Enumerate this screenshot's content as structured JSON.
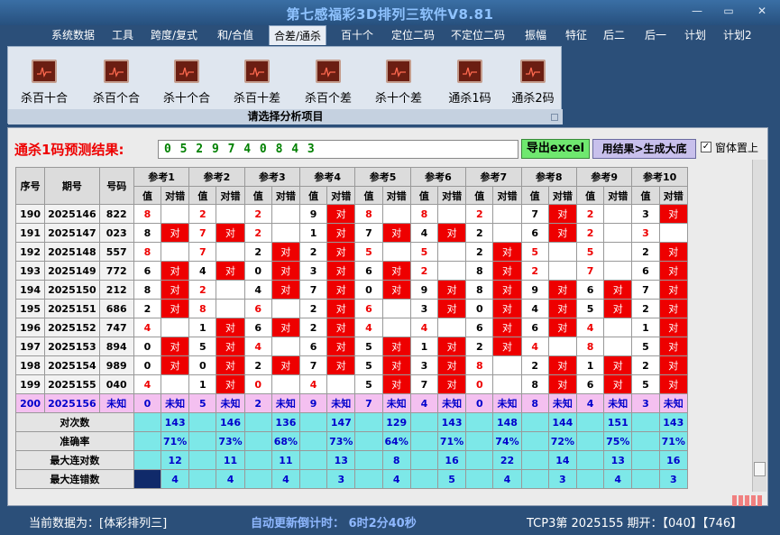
{
  "window": {
    "title": "第七感福彩3D排列三软件V8.81",
    "min": "—",
    "restore": "▭",
    "close": "✕"
  },
  "menu": [
    "系统数据",
    "工具",
    "跨度/复式",
    "和/合值",
    "合差/通杀",
    "百十个",
    "定位二码",
    "不定位二码",
    "振幅",
    "特征",
    "后二",
    "后一",
    "计划",
    "计划2"
  ],
  "active_menu": "合差/通杀",
  "tools": [
    "杀百十合",
    "杀百个合",
    "杀十个合",
    "杀百十差",
    "杀百个差",
    "杀十个差",
    "通杀1码",
    "通杀2码"
  ],
  "panel_caption": "请选择分析项目",
  "prediction": {
    "label": "通杀1码预测结果:",
    "value": "0 5 2 9 7 4 0 8 4 3"
  },
  "buttons": {
    "export": "导出excel",
    "generate": "用结果>生成大底",
    "ontop": "窗体置上",
    "ontop_check": "✓"
  },
  "table": {
    "head": {
      "seq": "序号",
      "period": "期号",
      "code": "号码",
      "val": "值",
      "chk": "对错"
    },
    "refs": [
      "参考1",
      "参考2",
      "参考3",
      "参考4",
      "参考5",
      "参考6",
      "参考7",
      "参考8",
      "参考9",
      "参考10"
    ],
    "rows": [
      {
        "seq": "190",
        "period": "2025146",
        "code": "822",
        "vals": [
          "8",
          "2",
          "2",
          "9",
          "8",
          "8",
          "2",
          "7",
          "2",
          "3"
        ],
        "red": [
          1,
          1,
          1,
          0,
          1,
          1,
          1,
          0,
          1,
          0
        ],
        "chk": [
          "",
          "",
          "",
          "对",
          "",
          "",
          "",
          "对",
          "",
          "对"
        ]
      },
      {
        "seq": "191",
        "period": "2025147",
        "code": "023",
        "vals": [
          "8",
          "7",
          "2",
          "1",
          "7",
          "4",
          "2",
          "6",
          "2",
          "3"
        ],
        "red": [
          0,
          1,
          1,
          0,
          0,
          0,
          0,
          0,
          1,
          1
        ],
        "chk": [
          "对",
          "对",
          "",
          "对",
          "对",
          "对",
          "",
          "对",
          "",
          ""
        ]
      },
      {
        "seq": "192",
        "period": "2025148",
        "code": "557",
        "vals": [
          "8",
          "7",
          "2",
          "2",
          "5",
          "5",
          "2",
          "5",
          "5",
          "2"
        ],
        "red": [
          1,
          1,
          0,
          0,
          1,
          1,
          0,
          1,
          1,
          0
        ],
        "chk": [
          "",
          "",
          "对",
          "对",
          "",
          "",
          "对",
          "",
          "",
          "对"
        ]
      },
      {
        "seq": "193",
        "period": "2025149",
        "code": "772",
        "vals": [
          "6",
          "4",
          "0",
          "3",
          "6",
          "2",
          "8",
          "2",
          "7",
          "6"
        ],
        "red": [
          0,
          0,
          0,
          0,
          0,
          1,
          0,
          1,
          1,
          0
        ],
        "chk": [
          "对",
          "对",
          "对",
          "对",
          "对",
          "",
          "对",
          "",
          "",
          "对"
        ]
      },
      {
        "seq": "194",
        "period": "2025150",
        "code": "212",
        "vals": [
          "8",
          "2",
          "4",
          "7",
          "0",
          "9",
          "8",
          "9",
          "6",
          "7"
        ],
        "red": [
          0,
          1,
          0,
          0,
          0,
          0,
          0,
          0,
          0,
          0
        ],
        "chk": [
          "对",
          "",
          "对",
          "对",
          "对",
          "对",
          "对",
          "对",
          "对",
          "对"
        ]
      },
      {
        "seq": "195",
        "period": "2025151",
        "code": "686",
        "vals": [
          "2",
          "8",
          "6",
          "2",
          "6",
          "3",
          "0",
          "4",
          "5",
          "2"
        ],
        "red": [
          0,
          1,
          1,
          0,
          1,
          0,
          0,
          0,
          0,
          0
        ],
        "chk": [
          "对",
          "",
          "",
          "对",
          "",
          "对",
          "对",
          "对",
          "对",
          "对"
        ]
      },
      {
        "seq": "196",
        "period": "2025152",
        "code": "747",
        "vals": [
          "4",
          "1",
          "6",
          "2",
          "4",
          "4",
          "6",
          "6",
          "4",
          "1"
        ],
        "red": [
          1,
          0,
          0,
          0,
          1,
          1,
          0,
          0,
          1,
          0
        ],
        "chk": [
          "",
          "对",
          "对",
          "对",
          "",
          "",
          "对",
          "对",
          "",
          "对"
        ]
      },
      {
        "seq": "197",
        "period": "2025153",
        "code": "894",
        "vals": [
          "0",
          "5",
          "4",
          "6",
          "5",
          "1",
          "2",
          "4",
          "8",
          "5"
        ],
        "red": [
          0,
          0,
          1,
          0,
          0,
          0,
          0,
          1,
          1,
          0
        ],
        "chk": [
          "对",
          "对",
          "",
          "对",
          "对",
          "对",
          "对",
          "",
          "",
          "对"
        ]
      },
      {
        "seq": "198",
        "period": "2025154",
        "code": "989",
        "vals": [
          "0",
          "0",
          "2",
          "7",
          "5",
          "3",
          "8",
          "2",
          "1",
          "2"
        ],
        "red": [
          0,
          0,
          0,
          0,
          0,
          0,
          1,
          0,
          0,
          0
        ],
        "chk": [
          "对",
          "对",
          "对",
          "对",
          "对",
          "对",
          "",
          "对",
          "对",
          "对"
        ]
      },
      {
        "seq": "199",
        "period": "2025155",
        "code": "040",
        "vals": [
          "4",
          "1",
          "0",
          "4",
          "5",
          "7",
          "0",
          "8",
          "6",
          "5"
        ],
        "red": [
          1,
          0,
          1,
          1,
          0,
          0,
          1,
          0,
          0,
          0
        ],
        "chk": [
          "",
          "对",
          "",
          "",
          "对",
          "对",
          "",
          "对",
          "对",
          "对"
        ]
      },
      {
        "seq": "200",
        "period": "2025156",
        "code": "未知",
        "vals": [
          "0",
          "5",
          "2",
          "9",
          "7",
          "4",
          "0",
          "8",
          "4",
          "3"
        ],
        "red": [
          0,
          0,
          0,
          0,
          0,
          0,
          0,
          0,
          0,
          0
        ],
        "chk": [
          "未知",
          "未知",
          "未知",
          "未知",
          "未知",
          "未知",
          "未知",
          "未知",
          "未知",
          "未知"
        ]
      }
    ],
    "stats": [
      {
        "label": "对次数",
        "values": [
          "143",
          "146",
          "136",
          "147",
          "129",
          "143",
          "148",
          "144",
          "151",
          "143"
        ]
      },
      {
        "label": "准确率",
        "values": [
          "71%",
          "73%",
          "68%",
          "73%",
          "64%",
          "71%",
          "74%",
          "72%",
          "75%",
          "71%"
        ]
      },
      {
        "label": "最大连对数",
        "values": [
          "12",
          "11",
          "11",
          "13",
          "8",
          "16",
          "22",
          "14",
          "13",
          "16"
        ]
      },
      {
        "label": "最大连错数",
        "values": [
          "4",
          "4",
          "4",
          "3",
          "4",
          "5",
          "4",
          "3",
          "4",
          "3"
        ]
      }
    ]
  },
  "status": {
    "source": "当前数据为：[体彩排列三]",
    "countdown": "自动更新倒计时：  6时2分40秒",
    "latest": "TCP3第 2025155 期开：【040】【746】"
  },
  "colors": {
    "red": "#e00000",
    "cyan": "#7de8e8",
    "pink": "#f4c0f0",
    "navy": "#102a6a",
    "title": "#8fc3ff"
  }
}
